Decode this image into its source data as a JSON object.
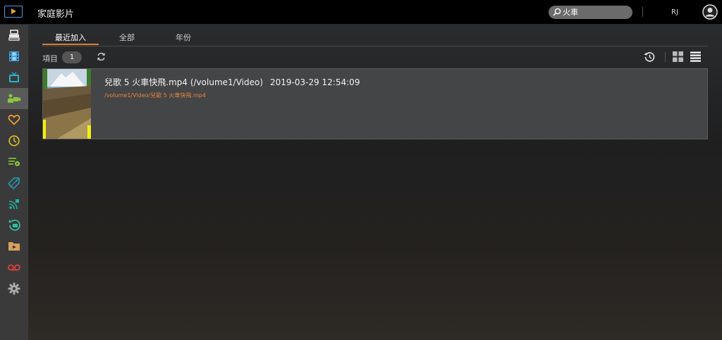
{
  "header": {
    "app_title": "家庭影片",
    "search_value": "火車",
    "user": "RJ"
  },
  "sidebar": {
    "items": [
      {
        "icon": "library-icon",
        "color": "#e8e8e8"
      },
      {
        "icon": "movie-icon",
        "color": "#3aa3e3"
      },
      {
        "icon": "tv-icon",
        "color": "#2ab0d0"
      },
      {
        "icon": "home-video-icon",
        "color": "#8cc63f",
        "active": true
      },
      {
        "icon": "heart-icon",
        "color": "#f0a030"
      },
      {
        "icon": "clock-icon",
        "color": "#e0c020"
      },
      {
        "icon": "playlist-icon",
        "color": "#8cc63f"
      },
      {
        "icon": "tag-icon",
        "color": "#20a0c0"
      },
      {
        "icon": "cast-icon",
        "color": "#20b0a0"
      },
      {
        "icon": "recent-icon",
        "color": "#30c0a0"
      },
      {
        "icon": "folder-icon",
        "color": "#d8a060"
      },
      {
        "icon": "recording-icon",
        "color": "#e04040"
      },
      {
        "icon": "settings-icon",
        "color": "#aaaaaa"
      }
    ]
  },
  "tabs": [
    {
      "label": "最近加入",
      "active": true
    },
    {
      "label": "全部"
    },
    {
      "label": "年份"
    }
  ],
  "toolbar": {
    "count_label": "項目",
    "count": "1"
  },
  "items": [
    {
      "title": "兒歌 5 火車快飛.mp4 (/volume1/Video)",
      "date": "2019-03-29 12:54:09",
      "path": "/volume1/Video/兒歌 5 火車快飛.mp4"
    }
  ],
  "colors": {
    "accent": "#e07a35"
  }
}
